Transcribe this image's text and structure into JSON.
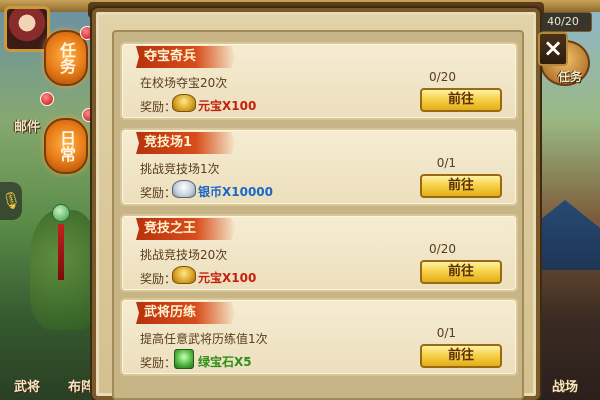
{
  "hud": {
    "counter": "40/20",
    "lantern_task": "任务",
    "lantern_daily": "日常",
    "mail": "邮件",
    "bottom_left_1": "武将",
    "bottom_left_2": "布阵",
    "right_task": "任务",
    "right_arena": "战场"
  },
  "dialog": {
    "close_label": "×",
    "tasks": [
      {
        "title": "夺宝奇兵",
        "description": "在校场夺宝20次",
        "reward_label": "奖励：",
        "reward_icon": "gold-ingot-icon",
        "reward_text": "元宝X100",
        "progress": "0/20",
        "button": "前往"
      },
      {
        "title": "竞技场1",
        "description": "挑战竞技场1次",
        "reward_label": "奖励：",
        "reward_icon": "silver-ingot-icon",
        "reward_text": "银币X10000",
        "progress": "0/1",
        "button": "前往"
      },
      {
        "title": "竞技之王",
        "description": "挑战竞技场20次",
        "reward_label": "奖励：",
        "reward_icon": "gold-ingot-icon",
        "reward_text": "元宝X100",
        "progress": "0/20",
        "button": "前往"
      },
      {
        "title": "武将历练",
        "description": "提高任意武将历练值1次",
        "reward_label": "奖励：",
        "reward_icon": "green-gem-icon",
        "reward_text": "绿宝石X5",
        "progress": "0/1",
        "button": "前往"
      }
    ]
  },
  "colors": {
    "panel": "#e2d2a8",
    "title_ribbon": "#c93a12",
    "button": "#f7d24a",
    "gold_text": "#c41f0f",
    "silver_text": "#1a67c6",
    "gem_text": "#2f8e17"
  }
}
